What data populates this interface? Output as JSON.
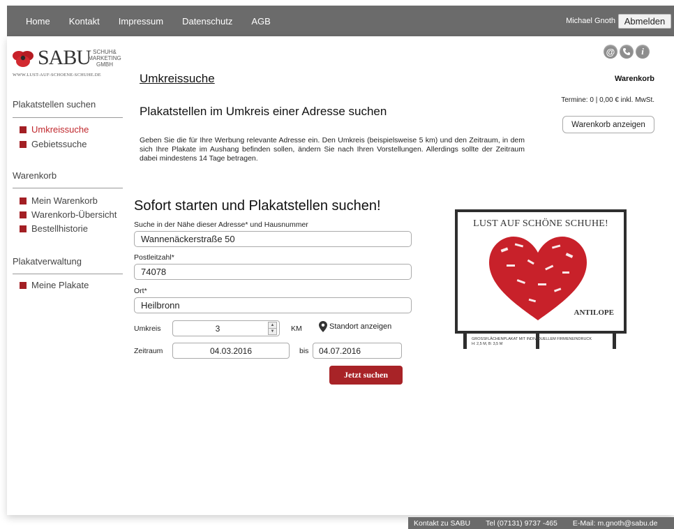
{
  "nav": {
    "items": [
      "Home",
      "Kontakt",
      "Impressum",
      "Datenschutz",
      "AGB"
    ],
    "user_name": "Michael Gnoth",
    "logout_label": "Abmelden"
  },
  "logo": {
    "main": "SABU",
    "side_line1": "SCHUH&",
    "side_line2": "MARKETING",
    "side_line3": "GMBH",
    "url": "WWW.LUST-AUF-SCHOENE-SCHUHE.DE"
  },
  "sidebar": {
    "sections": [
      {
        "title": "Plakatstellen suchen",
        "items": [
          {
            "label": "Umkreissuche",
            "active": true
          },
          {
            "label": "Gebietssuche",
            "active": false
          }
        ]
      },
      {
        "title": "Warenkorb",
        "items": [
          {
            "label": "Mein Warenkorb",
            "active": false
          },
          {
            "label": "Warenkorb-Übersicht",
            "active": false
          },
          {
            "label": "Bestellhistorie",
            "active": false
          }
        ]
      },
      {
        "title": "Plakatverwaltung",
        "items": [
          {
            "label": "Meine Plakate",
            "active": false
          }
        ]
      }
    ]
  },
  "main": {
    "page_title": "Umkreissuche",
    "sub_title": "Plakatstellen im Umkreis einer Adresse suchen",
    "intro": "Geben Sie die für Ihre Werbung relevante Adresse ein. Den Umkreis (beispielsweise 5 km) und den Zeitraum, in dem sich Ihre Plakate im Aushang befinden sollen, ändern Sie nach Ihren Vorstellungen. Allerdings sollte der Zeitraum dabei mindestens 14 Tage betragen.",
    "search_heading": "Sofort starten und Plakatstellen suchen!",
    "address_label": "Suche in der Nähe dieser Adresse* und Hausnummer",
    "address_value": "Wannenäckerstraße 50",
    "zip_label": "Postleitzahl*",
    "zip_value": "74078",
    "city_label": "Ort*",
    "city_value": "Heilbronn",
    "radius_label": "Umkreis",
    "radius_value": "3",
    "radius_unit": "KM",
    "locate_label": "Standort anzeigen",
    "period_label": "Zeitraum",
    "date_from": "04.03.2016",
    "bis_label": "bis",
    "date_to": "04.07.2016",
    "search_button": "Jetzt suchen"
  },
  "cart": {
    "title": "Warenkorb",
    "terms": "Termine: 0 | 0,00 € inkl. MwSt.",
    "button": "Warenkorb anzeigen"
  },
  "billboard": {
    "headline": "LUST AUF SCHÖNE SCHUHE!",
    "brand": "ANTILOPE",
    "caption_line1": "GROSSFLÄCHENPLAKAT MIT INDIVIDUELLEM FIRMENEINDRUCK",
    "caption_line2": "H: 2,5 M, B: 3,5 M",
    "accent_color": "#c8212a"
  },
  "footer": {
    "contact": "Kontakt zu SABU",
    "phone": "Tel (07131) 9737 -465",
    "email": "E-Mail: m.gnoth@sabu.de"
  },
  "colors": {
    "nav_bg": "#6b6b6b",
    "accent": "#a82327",
    "active_link": "#c0282d"
  }
}
